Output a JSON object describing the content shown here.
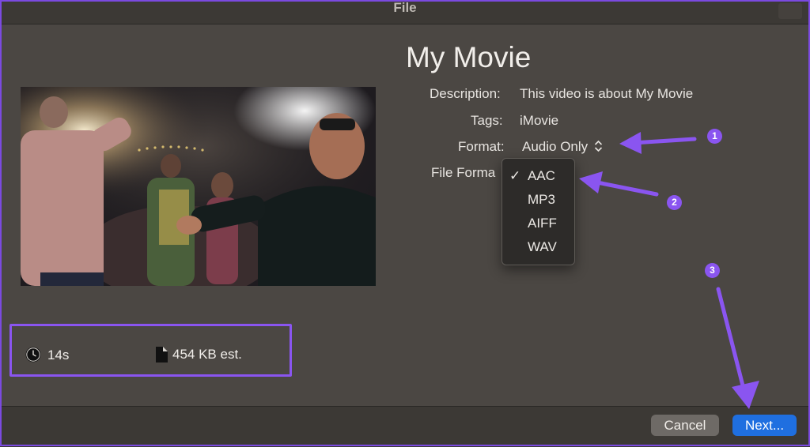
{
  "window": {
    "title": "File"
  },
  "movie": {
    "title": "My Movie"
  },
  "fields": {
    "description": {
      "label": "Description:",
      "value": "This video is about My Movie"
    },
    "tags": {
      "label": "Tags:",
      "value": "iMovie"
    },
    "format": {
      "label": "Format:",
      "value": "Audio Only"
    },
    "file_format": {
      "label": "File Forma"
    }
  },
  "file_format_menu": {
    "checkmark": "✓",
    "options": [
      "AAC",
      "MP3",
      "AIFF",
      "WAV"
    ],
    "selected": "AAC"
  },
  "info": {
    "duration": "14s",
    "size": "454 KB est."
  },
  "buttons": {
    "cancel": "Cancel",
    "next": "Next..."
  },
  "annotations": {
    "badges": [
      "1",
      "2",
      "3"
    ]
  },
  "colors": {
    "annotation_purple": "#8a55f0",
    "primary_button": "#1f6fe0",
    "dialog_background": "#4b4743"
  }
}
